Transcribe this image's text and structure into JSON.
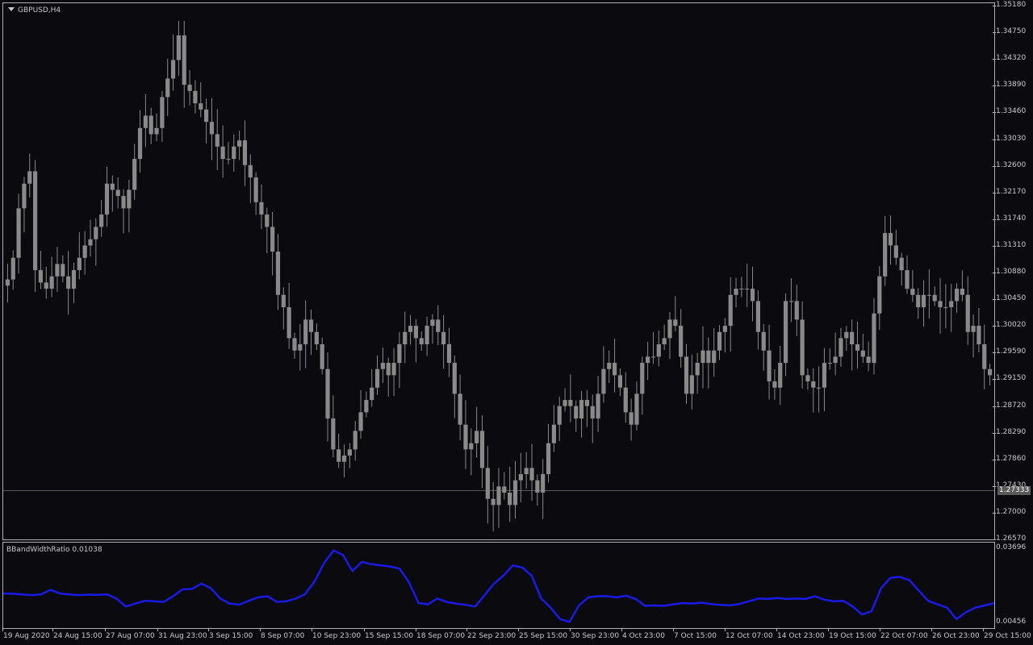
{
  "chart": {
    "symbol": "GBPUSD,H4",
    "indicator_name": "BBandWidthRatio 0.01038",
    "current_price": "1.27333",
    "price_axis": [
      "1.35180",
      "1.34750",
      "1.34320",
      "1.33890",
      "1.33460",
      "1.33030",
      "1.32600",
      "1.32170",
      "1.31740",
      "1.31310",
      "1.30880",
      "1.30450",
      "1.30020",
      "1.29590",
      "1.29150",
      "1.28720",
      "1.28290",
      "1.27860",
      "1.27430",
      "1.27000",
      "1.26570"
    ],
    "indicator_axis": [
      "0.03696",
      "0.00456"
    ],
    "time_axis": [
      "19 Aug 2020",
      "24 Aug 15:00",
      "27 Aug 07:00",
      "31 Aug 23:00",
      "3 Sep 15:00",
      "8 Sep 07:00",
      "10 Sep 23:00",
      "15 Sep 15:00",
      "18 Sep 07:00",
      "22 Sep 23:00",
      "25 Sep 15:00",
      "30 Sep 23:00",
      "4 Oct 23:00",
      "7 Oct 15:00",
      "12 Oct 07:00",
      "14 Oct 23:00",
      "19 Oct 15:00",
      "22 Oct 07:00",
      "26 Oct 23:00",
      "29 Oct 15:00"
    ],
    "colors": {
      "background": "#0a0a0f",
      "candle": "#8a8a8a",
      "indicator_line": "#1a1ae6",
      "grid_line": "#707070"
    }
  },
  "chart_data": {
    "type": "line",
    "price_range": [
      1.2657,
      1.3518
    ],
    "indicator_range": [
      0.00456,
      0.03696
    ],
    "close_series": [
      1.3075,
      1.311,
      1.319,
      1.323,
      1.325,
      1.309,
      1.307,
      1.306,
      1.308,
      1.31,
      1.308,
      1.306,
      1.309,
      1.311,
      1.313,
      1.314,
      1.316,
      1.318,
      1.323,
      1.322,
      1.321,
      1.319,
      1.322,
      1.327,
      1.332,
      1.334,
      1.331,
      1.332,
      1.337,
      1.34,
      1.343,
      1.347,
      1.339,
      1.338,
      1.336,
      1.335,
      1.333,
      1.331,
      1.329,
      1.327,
      1.327,
      1.329,
      1.33,
      1.326,
      1.324,
      1.32,
      1.318,
      1.316,
      1.312,
      1.305,
      1.303,
      1.298,
      1.296,
      1.297,
      1.301,
      1.299,
      1.297,
      1.293,
      1.285,
      1.28,
      1.278,
      1.279,
      1.28,
      1.283,
      1.286,
      1.288,
      1.29,
      1.293,
      1.294,
      1.292,
      1.294,
      1.297,
      1.299,
      1.3,
      1.298,
      1.297,
      1.3,
      1.301,
      1.299,
      1.297,
      1.294,
      1.289,
      1.284,
      1.28,
      1.281,
      1.283,
      1.277,
      1.272,
      1.271,
      1.274,
      1.273,
      1.271,
      1.275,
      1.276,
      1.277,
      1.275,
      1.273,
      1.276,
      1.281,
      1.284,
      1.287,
      1.288,
      1.287,
      1.285,
      1.288,
      1.287,
      1.285,
      1.289,
      1.293,
      1.294,
      1.292,
      1.29,
      1.286,
      1.284,
      1.289,
      1.294,
      1.295,
      1.295,
      1.297,
      1.298,
      1.301,
      1.3,
      1.295,
      1.289,
      1.292,
      1.294,
      1.296,
      1.294,
      1.296,
      1.299,
      1.3,
      1.305,
      1.306,
      1.306,
      1.306,
      1.304,
      1.299,
      1.296,
      1.291,
      1.29,
      1.294,
      1.304,
      1.304,
      1.301,
      1.292,
      1.291,
      1.29,
      1.29,
      1.294,
      1.294,
      1.295,
      1.298,
      1.299,
      1.297,
      1.296,
      1.295,
      1.294,
      1.302,
      1.308,
      1.315,
      1.313,
      1.311,
      1.309,
      1.306,
      1.305,
      1.303,
      1.305,
      1.305,
      1.304,
      1.303,
      1.303,
      1.304,
      1.306,
      1.305,
      1.299,
      1.3,
      1.297,
      1.293,
      1.292
    ],
    "indicator_series": [
      0.0172,
      0.0171,
      0.0168,
      0.0165,
      0.0168,
      0.0188,
      0.0172,
      0.0168,
      0.0165,
      0.0167,
      0.0166,
      0.0168,
      0.015,
      0.0115,
      0.0128,
      0.014,
      0.0138,
      0.0135,
      0.016,
      0.019,
      0.0192,
      0.0215,
      0.0195,
      0.015,
      0.0128,
      0.0123,
      0.014,
      0.0155,
      0.016,
      0.0135,
      0.0138,
      0.015,
      0.017,
      0.0225,
      0.0305,
      0.036,
      0.034,
      0.027,
      0.031,
      0.03,
      0.0295,
      0.029,
      0.028,
      0.022,
      0.013,
      0.0125,
      0.015,
      0.0135,
      0.0128,
      0.0122,
      0.0115,
      0.0165,
      0.0215,
      0.025,
      0.0295,
      0.0285,
      0.025,
      0.015,
      0.011,
      0.006,
      0.0048,
      0.012,
      0.0155,
      0.016,
      0.016,
      0.0155,
      0.0162,
      0.0148,
      0.0118,
      0.012,
      0.0118,
      0.0125,
      0.013,
      0.0128,
      0.0132,
      0.0126,
      0.0122,
      0.012,
      0.0126,
      0.0138,
      0.015,
      0.0148,
      0.0152,
      0.0148,
      0.015,
      0.0148,
      0.016,
      0.0145,
      0.0138,
      0.014,
      0.0115,
      0.008,
      0.0095,
      0.0195,
      0.024,
      0.0245,
      0.023,
      0.0185,
      0.014,
      0.0125,
      0.011,
      0.006,
      0.009,
      0.011,
      0.012,
      0.013
    ]
  }
}
